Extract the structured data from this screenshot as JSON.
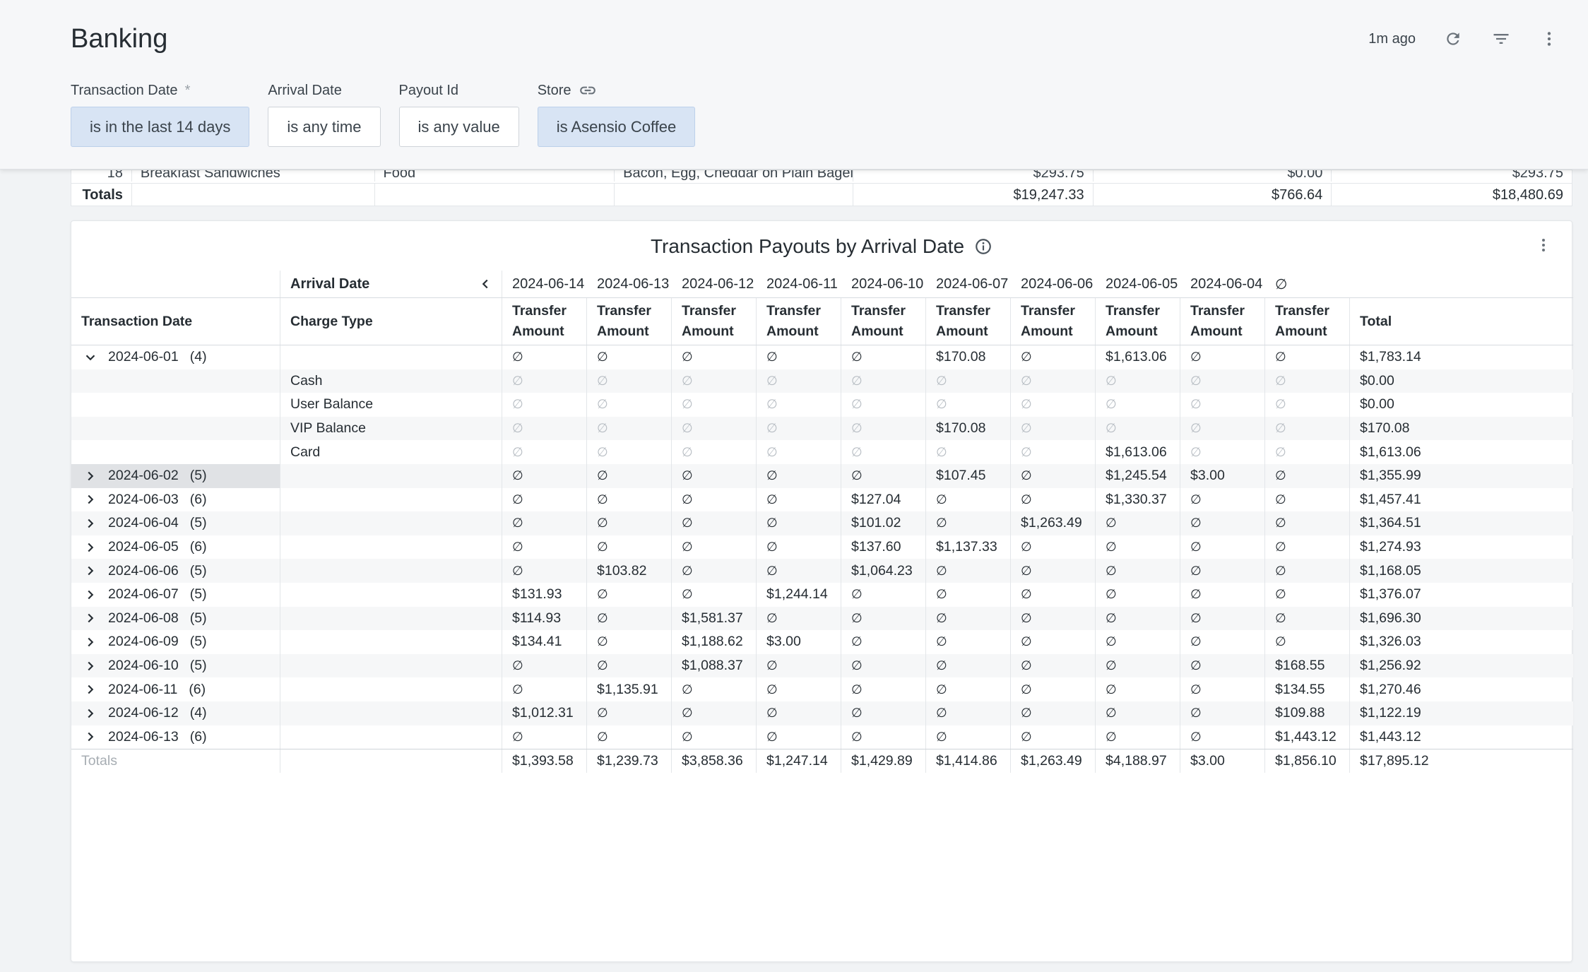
{
  "page": {
    "title": "Banking",
    "updated": "1m ago"
  },
  "icons": {
    "refresh": "refresh-icon",
    "filter": "filter-icon",
    "more": "more-vert-icon",
    "link": "link-icon",
    "info": "info-icon",
    "chevron_left": "chevron-left-icon",
    "chevron_down": "chevron-down-icon",
    "chevron_right": "chevron-right-icon"
  },
  "filters": [
    {
      "label": "Transaction Date",
      "required": "*",
      "value": "is in the last 14 days",
      "active": true
    },
    {
      "label": "Arrival Date",
      "required": "",
      "value": "is any time",
      "active": false
    },
    {
      "label": "Payout Id",
      "required": "",
      "value": "is any value",
      "active": false
    },
    {
      "label": "Store",
      "required": "",
      "value": "is Asensio Coffee",
      "active": true
    }
  ],
  "top_table": {
    "partial_row": [
      "18",
      "Breakfast Sandwiches",
      "Food",
      "Bacon, Egg, Cheddar on Plain Bagel",
      "$293.75",
      "$0.00",
      "$293.75"
    ],
    "totals": {
      "label": "Totals",
      "gross": "$19,247.33",
      "fees": "$766.64",
      "net": "$18,480.69"
    }
  },
  "pivot": {
    "title": "Transaction Payouts by Arrival Date",
    "arrival_label": "Arrival Date",
    "row_header_1": "Transaction Date",
    "row_header_2": "Charge Type",
    "dates": [
      "2024-06-14",
      "2024-06-13",
      "2024-06-12",
      "2024-06-11",
      "2024-06-10",
      "2024-06-07",
      "2024-06-06",
      "2024-06-05",
      "2024-06-04",
      "∅"
    ],
    "measure_line1": "Transfer",
    "measure_line2": "Amount",
    "total_label": "Total",
    "null_symbol": "∅",
    "rows": [
      {
        "date": "2024-06-01",
        "count": "(4)",
        "expanded": true,
        "charge": "",
        "values": [
          "∅",
          "∅",
          "∅",
          "∅",
          "∅",
          "$170.08",
          "∅",
          "$1,613.06",
          "∅",
          "∅"
        ],
        "total": "$1,783.14"
      },
      {
        "date": "",
        "count": "",
        "charge": "Cash",
        "sub": true,
        "values": [
          "∅",
          "∅",
          "∅",
          "∅",
          "∅",
          "∅",
          "∅",
          "∅",
          "∅",
          "∅"
        ],
        "total": "$0.00"
      },
      {
        "date": "",
        "count": "",
        "charge": "User Balance",
        "sub": true,
        "values": [
          "∅",
          "∅",
          "∅",
          "∅",
          "∅",
          "∅",
          "∅",
          "∅",
          "∅",
          "∅"
        ],
        "total": "$0.00"
      },
      {
        "date": "",
        "count": "",
        "charge": "VIP Balance",
        "sub": true,
        "values": [
          "∅",
          "∅",
          "∅",
          "∅",
          "∅",
          "$170.08",
          "∅",
          "∅",
          "∅",
          "∅"
        ],
        "total": "$170.08"
      },
      {
        "date": "",
        "count": "",
        "charge": "Card",
        "sub": true,
        "values": [
          "∅",
          "∅",
          "∅",
          "∅",
          "∅",
          "∅",
          "∅",
          "$1,613.06",
          "∅",
          "∅"
        ],
        "total": "$1,613.06"
      },
      {
        "date": "2024-06-02",
        "count": "(5)",
        "selected": true,
        "charge": "",
        "values": [
          "∅",
          "∅",
          "∅",
          "∅",
          "∅",
          "$107.45",
          "∅",
          "$1,245.54",
          "$3.00",
          "∅"
        ],
        "total": "$1,355.99"
      },
      {
        "date": "2024-06-03",
        "count": "(6)",
        "charge": "",
        "values": [
          "∅",
          "∅",
          "∅",
          "∅",
          "$127.04",
          "∅",
          "∅",
          "$1,330.37",
          "∅",
          "∅"
        ],
        "total": "$1,457.41"
      },
      {
        "date": "2024-06-04",
        "count": "(5)",
        "charge": "",
        "values": [
          "∅",
          "∅",
          "∅",
          "∅",
          "$101.02",
          "∅",
          "$1,263.49",
          "∅",
          "∅",
          "∅"
        ],
        "total": "$1,364.51"
      },
      {
        "date": "2024-06-05",
        "count": "(6)",
        "charge": "",
        "values": [
          "∅",
          "∅",
          "∅",
          "∅",
          "$137.60",
          "$1,137.33",
          "∅",
          "∅",
          "∅",
          "∅"
        ],
        "total": "$1,274.93"
      },
      {
        "date": "2024-06-06",
        "count": "(5)",
        "charge": "",
        "values": [
          "∅",
          "$103.82",
          "∅",
          "∅",
          "$1,064.23",
          "∅",
          "∅",
          "∅",
          "∅",
          "∅"
        ],
        "total": "$1,168.05"
      },
      {
        "date": "2024-06-07",
        "count": "(5)",
        "charge": "",
        "values": [
          "$131.93",
          "∅",
          "∅",
          "$1,244.14",
          "∅",
          "∅",
          "∅",
          "∅",
          "∅",
          "∅"
        ],
        "total": "$1,376.07"
      },
      {
        "date": "2024-06-08",
        "count": "(5)",
        "charge": "",
        "values": [
          "$114.93",
          "∅",
          "$1,581.37",
          "∅",
          "∅",
          "∅",
          "∅",
          "∅",
          "∅",
          "∅"
        ],
        "total": "$1,696.30"
      },
      {
        "date": "2024-06-09",
        "count": "(5)",
        "charge": "",
        "values": [
          "$134.41",
          "∅",
          "$1,188.62",
          "$3.00",
          "∅",
          "∅",
          "∅",
          "∅",
          "∅",
          "∅"
        ],
        "total": "$1,326.03"
      },
      {
        "date": "2024-06-10",
        "count": "(5)",
        "charge": "",
        "values": [
          "∅",
          "∅",
          "$1,088.37",
          "∅",
          "∅",
          "∅",
          "∅",
          "∅",
          "∅",
          "$168.55"
        ],
        "total": "$1,256.92"
      },
      {
        "date": "2024-06-11",
        "count": "(6)",
        "charge": "",
        "values": [
          "∅",
          "$1,135.91",
          "∅",
          "∅",
          "∅",
          "∅",
          "∅",
          "∅",
          "∅",
          "$134.55"
        ],
        "total": "$1,270.46"
      },
      {
        "date": "2024-06-12",
        "count": "(4)",
        "charge": "",
        "values": [
          "$1,012.31",
          "∅",
          "∅",
          "∅",
          "∅",
          "∅",
          "∅",
          "∅",
          "∅",
          "$109.88"
        ],
        "total": "$1,122.19"
      },
      {
        "date": "2024-06-13",
        "count": "(6)",
        "charge": "",
        "values": [
          "∅",
          "∅",
          "∅",
          "∅",
          "∅",
          "∅",
          "∅",
          "∅",
          "∅",
          "$1,443.12"
        ],
        "total": "$1,443.12"
      }
    ],
    "totals": {
      "label": "Totals",
      "values": [
        "$1,393.58",
        "$1,239.73",
        "$3,858.36",
        "$1,247.14",
        "$1,429.89",
        "$1,414.86",
        "$1,263.49",
        "$4,188.97",
        "$3.00",
        "$1,856.10"
      ],
      "total": "$17,895.12"
    }
  }
}
